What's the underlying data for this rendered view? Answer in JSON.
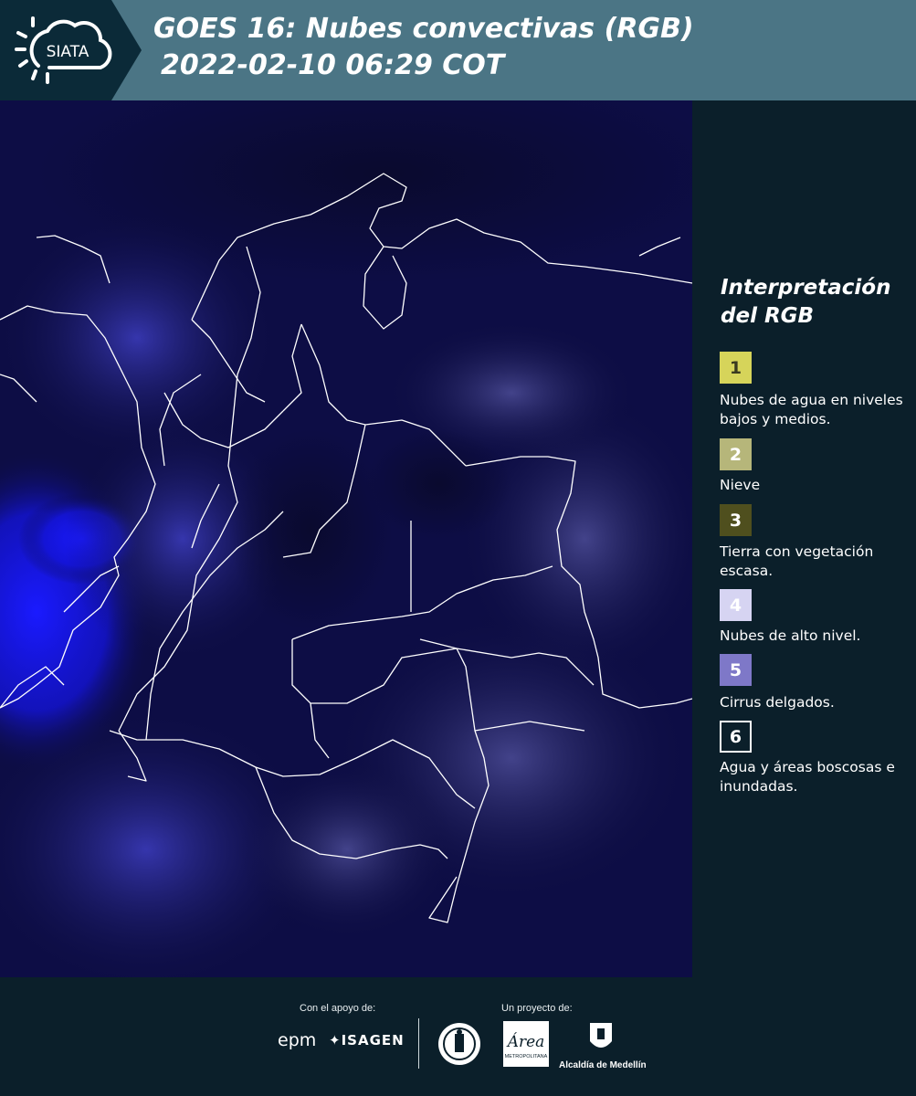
{
  "header": {
    "logo_text": "SIATA",
    "title_line1": "GOES 16: Nubes convectivas (RGB)",
    "title_line2": "2022-02-10 06:29 COT"
  },
  "legend": {
    "title": "Interpretación del RGB",
    "items": [
      {
        "number": "1",
        "color": "#d6d45a",
        "text_color": "#3a3a20",
        "label": "Nubes de agua en niveles bajos y medios."
      },
      {
        "number": "2",
        "color": "#b6b67a",
        "text_color": "#ffffff",
        "label": "Nieve"
      },
      {
        "number": "3",
        "color": "#4f4f1e",
        "text_color": "#ffffff",
        "label": "Tierra con vegetación escasa."
      },
      {
        "number": "4",
        "color": "#d6d4f2",
        "text_color": "#ffffff",
        "label": "Nubes de alto nivel."
      },
      {
        "number": "5",
        "color": "#7e78c8",
        "text_color": "#ffffff",
        "label": "Cirrus delgados."
      },
      {
        "number": "6",
        "color": "#0b1f2a",
        "text_color": "#ffffff",
        "label": "Agua y áreas boscosas e inundadas."
      }
    ]
  },
  "footer": {
    "support_caption": "Con el apoyo de:",
    "project_caption": "Un proyecto de:",
    "epm_logo": "epm",
    "isagen_logo": "ISAGEN",
    "area_logo": "Área",
    "area_subtitle": "METROPOLITANA",
    "alcaldia_logo": "Alcaldía de Medellín"
  },
  "colors": {
    "header_bg": "#4b7585",
    "logo_band": "#0b2a38",
    "page_bg": "#0b1f2a",
    "map_base": "#0b0b3a",
    "boundary": "#ffffff"
  }
}
